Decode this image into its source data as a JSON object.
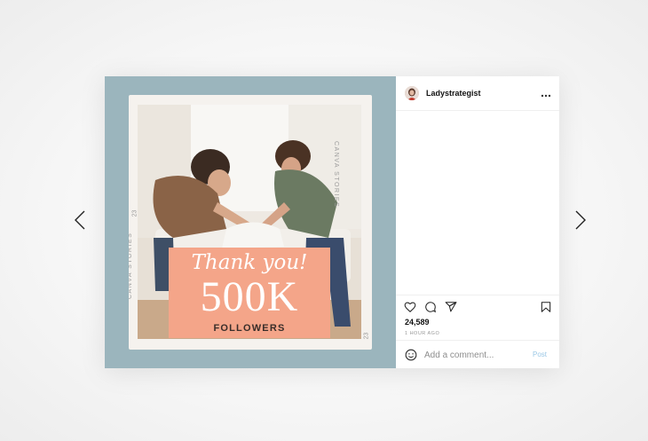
{
  "carousel": {
    "prev_icon": "chevron-left-icon",
    "next_icon": "chevron-right-icon"
  },
  "post": {
    "username": "Ladystrategist",
    "likes": "24,589",
    "timestamp": "1 HOUR AGO",
    "comment_placeholder": "Add a comment...",
    "post_label": "Post"
  },
  "graphic": {
    "script_text": "Thank you!",
    "big_text": "500K",
    "small_text": "FOLLOWERS",
    "side_brand": "CANVA STORIES",
    "side_number": "23",
    "background_color": "#9bb5bd",
    "promo_color": "#f4a589"
  },
  "icons": {
    "more": "more-horizontal-icon",
    "like": "heart-icon",
    "comment": "comment-icon",
    "share": "send-icon",
    "save": "bookmark-icon",
    "emoji": "emoji-icon"
  }
}
